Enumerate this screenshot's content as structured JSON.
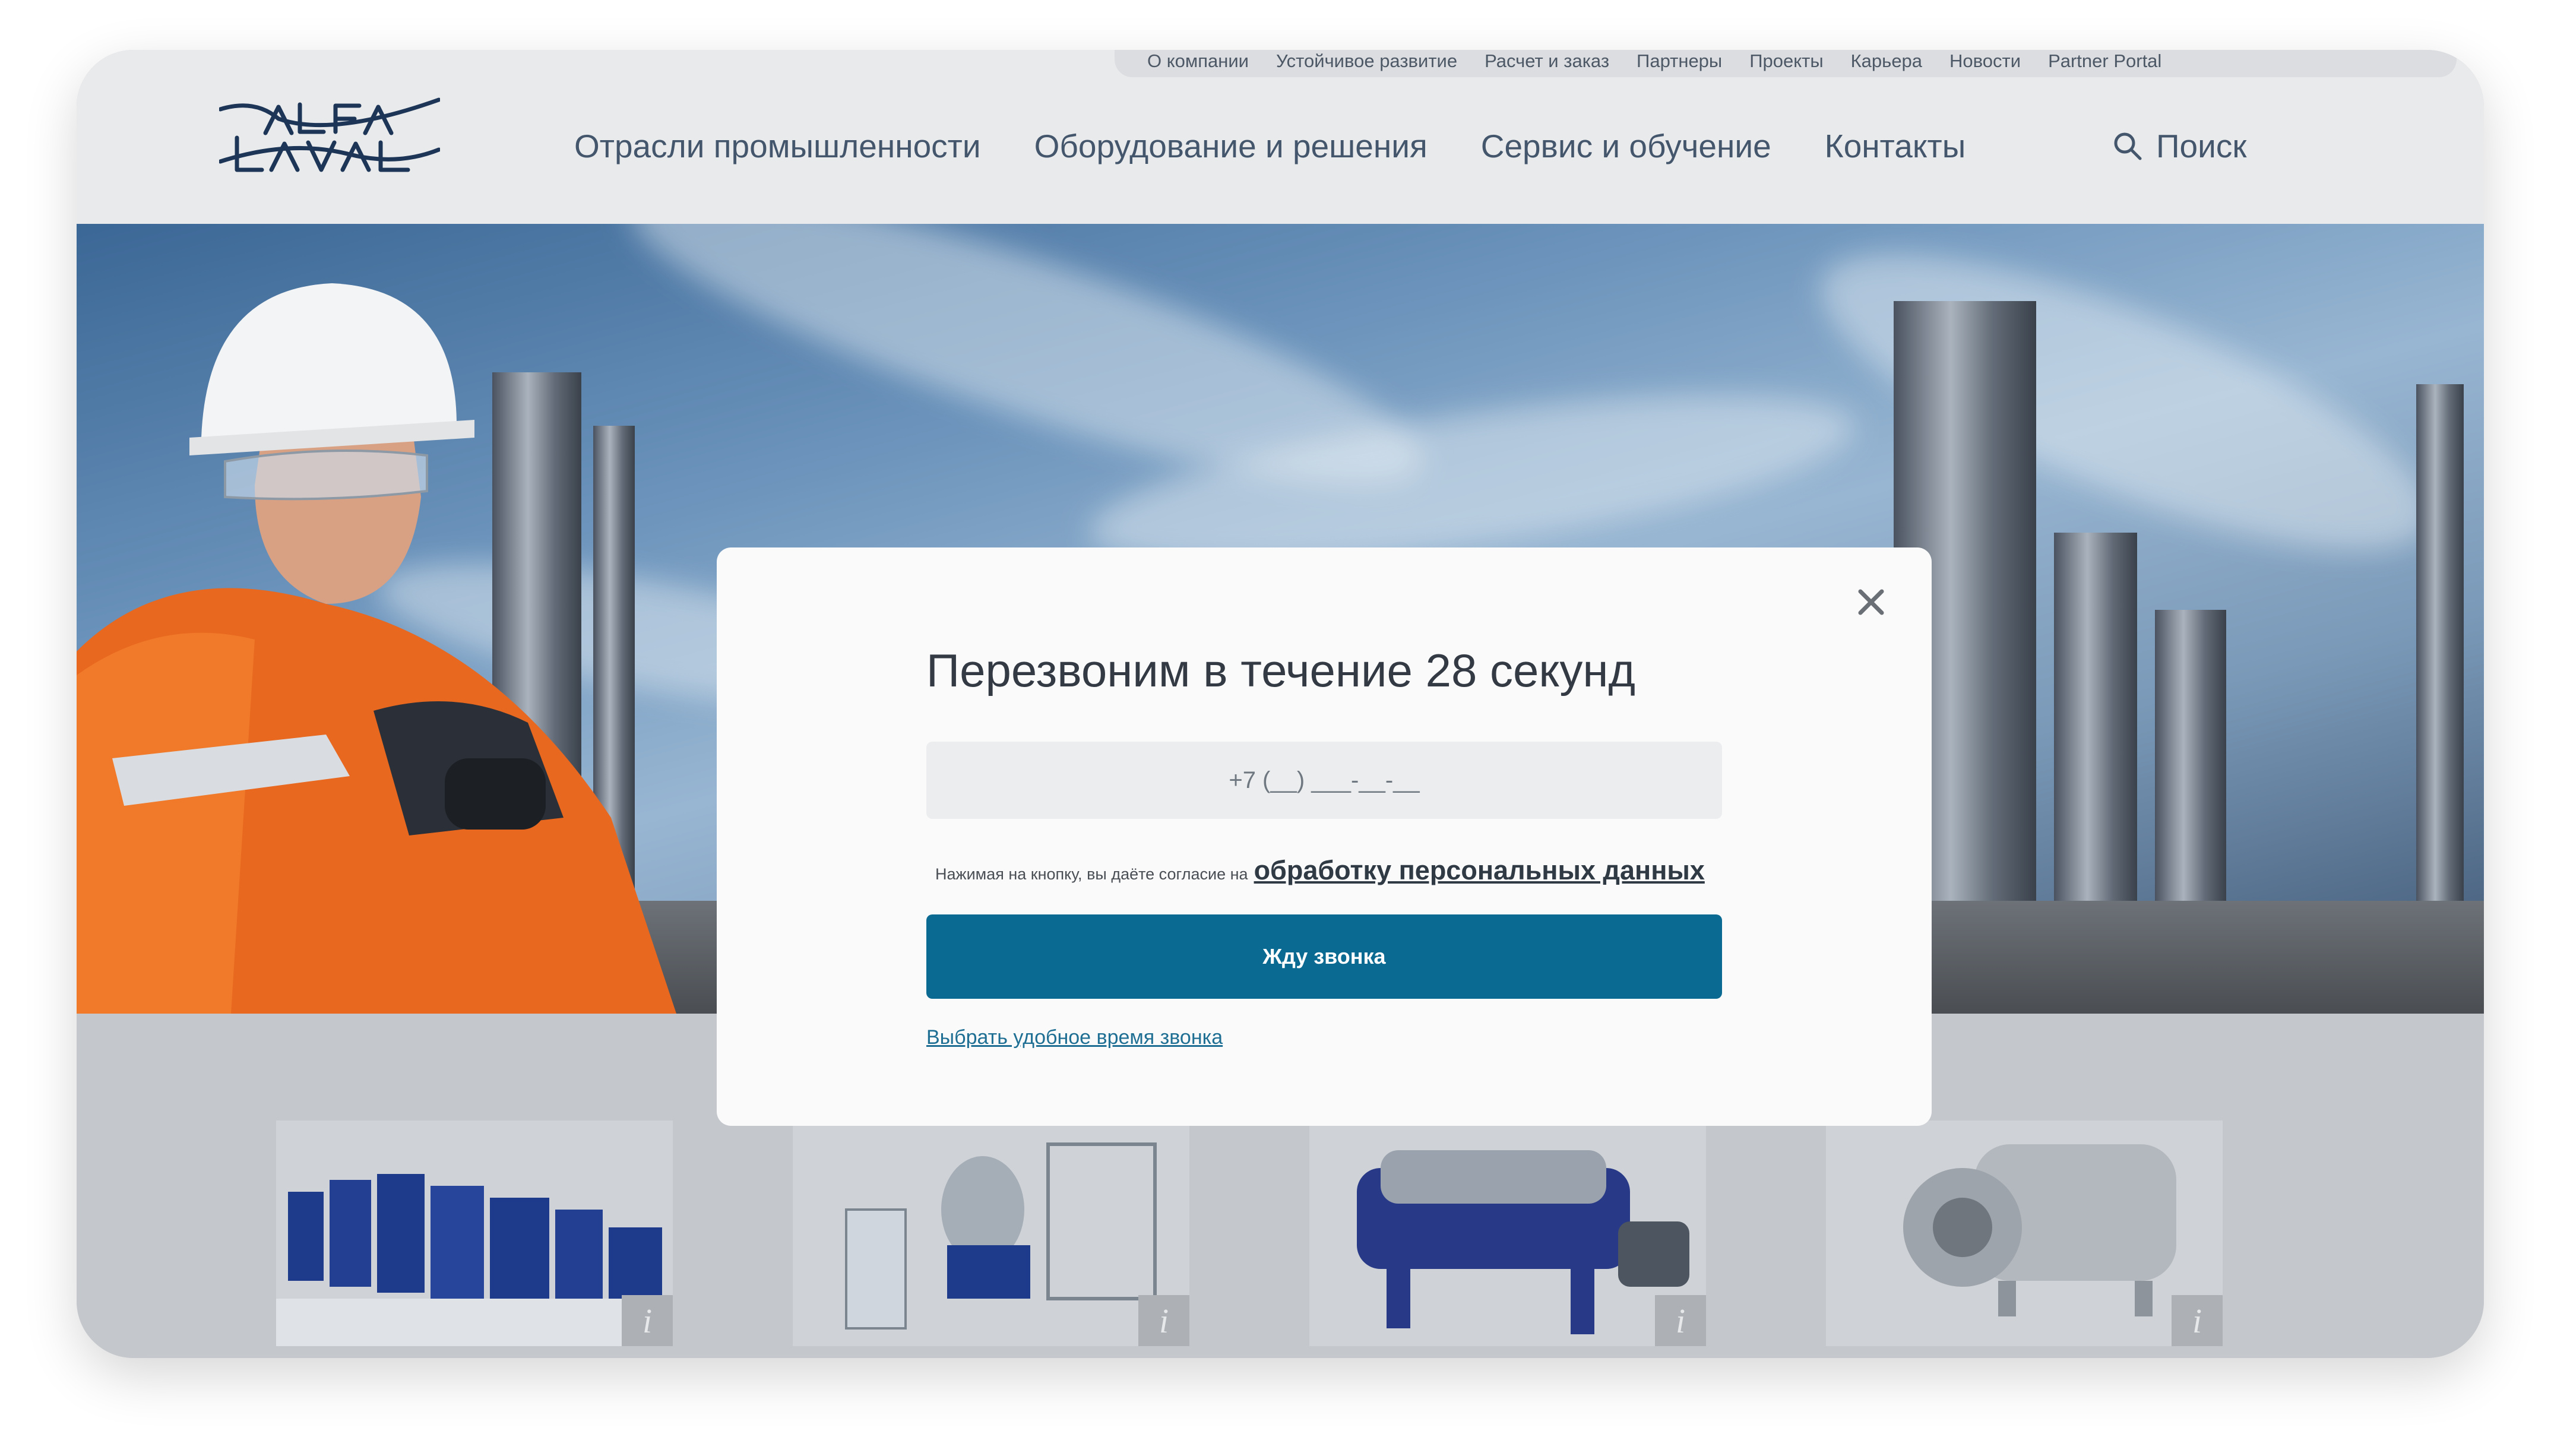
{
  "topbar": {
    "items": [
      "О компании",
      "Устойчивое развитие",
      "Расчет и заказ",
      "Партнеры",
      "Проекты",
      "Карьера",
      "Новости",
      "Partner Portal"
    ]
  },
  "logo": {
    "name": "Alfa Laval"
  },
  "nav": {
    "items": [
      "Отрасли промышленности",
      "Оборудование и решения",
      "Сервис и обучение",
      "Контакты"
    ],
    "search_label": "Поиск"
  },
  "modal": {
    "title": "Перезвоним в течение 28 секунд",
    "phone_placeholder": "+7 (__) ___-__-__",
    "consent_text": "Нажимая на кнопку, вы даёте согласие на",
    "consent_link": "обработку персональных данных",
    "submit_label": "Жду звонка",
    "alt_link": "Выбрать удобное время звонка"
  },
  "products": {
    "info_label": "i"
  },
  "colors": {
    "brand_blue": "#0b6a92",
    "logo_navy": "#1d3557",
    "nav_text": "#44566c"
  }
}
